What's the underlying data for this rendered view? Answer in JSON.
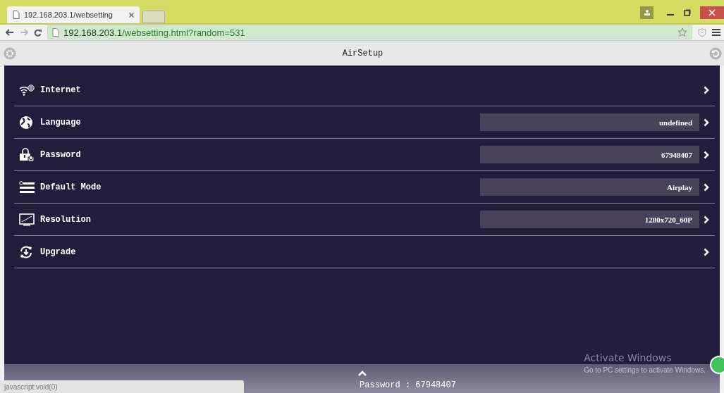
{
  "browser": {
    "tab": {
      "title": "192.168.203.1/websetting"
    },
    "address": {
      "host": "192.168.203.1",
      "path": "/websetting.html?random=531"
    }
  },
  "app": {
    "title": "AirSetup"
  },
  "settings": [
    {
      "kind": "internet",
      "label": "Internet"
    },
    {
      "kind": "language",
      "label": "Language",
      "value": "undefined"
    },
    {
      "kind": "password",
      "label": "Password",
      "value": "67948407"
    },
    {
      "kind": "mode",
      "label": "Default Mode",
      "value": "Airplay"
    },
    {
      "kind": "resolution",
      "label": "Resolution",
      "value": "1280x720_60P"
    },
    {
      "kind": "upgrade",
      "label": "Upgrade"
    }
  ],
  "footer": {
    "text": "Password : 67948407"
  },
  "status_bubble": {
    "text": "javascript:void(0)"
  },
  "os_notice": {
    "title": "Activate Windows",
    "text": "Go to PC settings to activate Windows."
  }
}
